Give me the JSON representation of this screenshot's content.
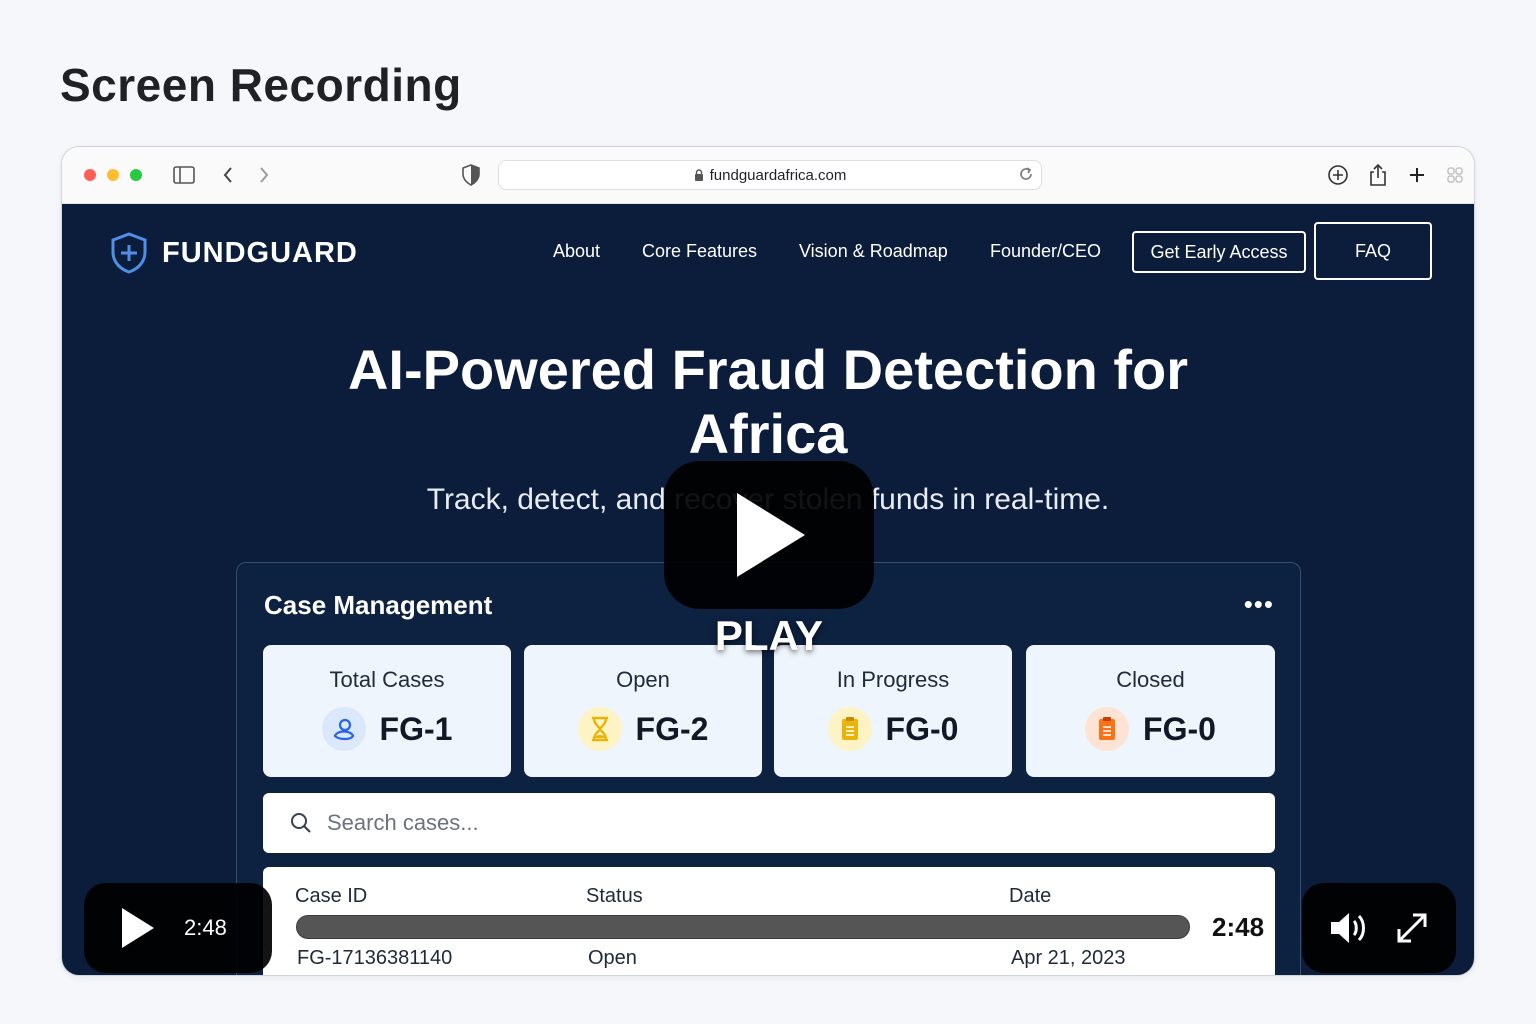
{
  "page": {
    "heading": "Screen Recording"
  },
  "browser": {
    "url": "fundguardafrica.com"
  },
  "site": {
    "brand": "FUNDGUARD",
    "nav": {
      "about": "About",
      "core_features": "Core Features",
      "vision": "Vision & Roadmap",
      "founder": "Founder/CEO",
      "early_access": "Get Early Access",
      "faq": "FAQ"
    },
    "hero": {
      "title_line1": "AI-Powered Fraud Detection for",
      "title_line2": "Africa",
      "subtitle": "Track, detect, and recover stolen funds in real-time."
    },
    "panel": {
      "title": "Case Management",
      "more": "•••",
      "stats": [
        {
          "label": "Total Cases",
          "value": "FG-1",
          "icon": "user-icon",
          "color": "#2563eb"
        },
        {
          "label": "Open",
          "value": "FG-2",
          "icon": "hourglass-icon",
          "color": "#eab308"
        },
        {
          "label": "In Progress",
          "value": "FG-0",
          "icon": "clipboard-icon",
          "color": "#eab308"
        },
        {
          "label": "Closed",
          "value": "FG-0",
          "icon": "clipboard-icon",
          "color": "#f97316"
        }
      ],
      "search_placeholder": "Search cases...",
      "table": {
        "headers": {
          "case_id": "Case ID",
          "status": "Status",
          "date": "Date"
        },
        "rows": [
          {
            "case_id": "FG-17136381140",
            "status": "Open",
            "date": "Apr 21, 2023"
          }
        ]
      }
    }
  },
  "video": {
    "play_label": "PLAY",
    "time_left": "2:48",
    "time_right": "2:48",
    "progress": 0
  }
}
